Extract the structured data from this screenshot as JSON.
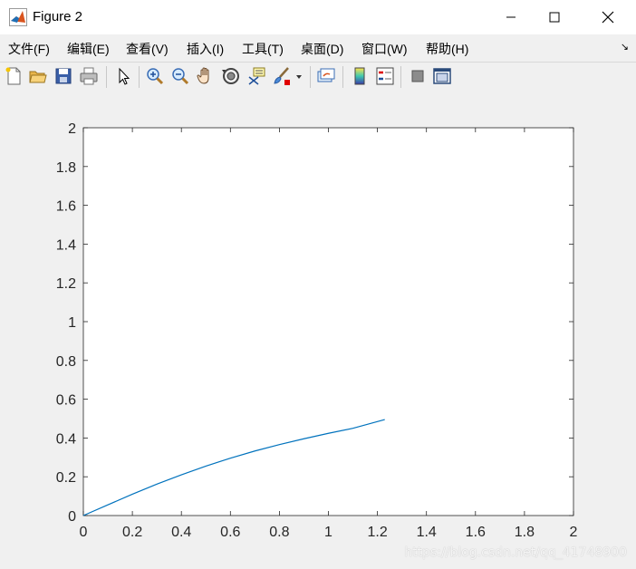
{
  "window": {
    "title": "Figure 2"
  },
  "menu": {
    "items": [
      "文件(F)",
      "编辑(E)",
      "查看(V)",
      "插入(I)",
      "工具(T)",
      "桌面(D)",
      "窗口(W)",
      "帮助(H)"
    ],
    "overflow_arrow": "↘"
  },
  "toolbar": {
    "icons": [
      "new-figure-icon",
      "open-file-icon",
      "save-icon",
      "print-icon",
      "pointer-icon",
      "zoom-in-icon",
      "zoom-out-icon",
      "pan-hand-icon",
      "rotate-3d-icon",
      "data-cursor-icon",
      "brush-icon",
      "brush-dropdown-icon",
      "link-plot-icon",
      "colorbar-icon",
      "legend-icon",
      "hide-plot-tools-icon",
      "show-plot-tools-icon"
    ]
  },
  "chart_data": {
    "type": "line",
    "title": "",
    "xlabel": "",
    "ylabel": "",
    "xlim": [
      0,
      2
    ],
    "ylim": [
      0,
      2
    ],
    "xticks": [
      "0",
      "0.2",
      "0.4",
      "0.6",
      "0.8",
      "1",
      "1.2",
      "1.4",
      "1.6",
      "1.8",
      "2"
    ],
    "yticks": [
      "0",
      "0.2",
      "0.4",
      "0.6",
      "0.8",
      "1",
      "1.2",
      "1.4",
      "1.6",
      "1.8",
      "2"
    ],
    "grid": false,
    "line_color": "#0072bd",
    "series": [
      {
        "x": [
          0,
          0.1,
          0.2,
          0.3,
          0.4,
          0.5,
          0.6,
          0.7,
          0.8,
          0.9,
          1.0,
          1.1,
          1.23
        ],
        "y": [
          0,
          0.055,
          0.11,
          0.162,
          0.21,
          0.255,
          0.296,
          0.333,
          0.366,
          0.396,
          0.424,
          0.45,
          0.495
        ]
      }
    ]
  },
  "watermark": "https://blog.csdn.net/qq_41748900"
}
